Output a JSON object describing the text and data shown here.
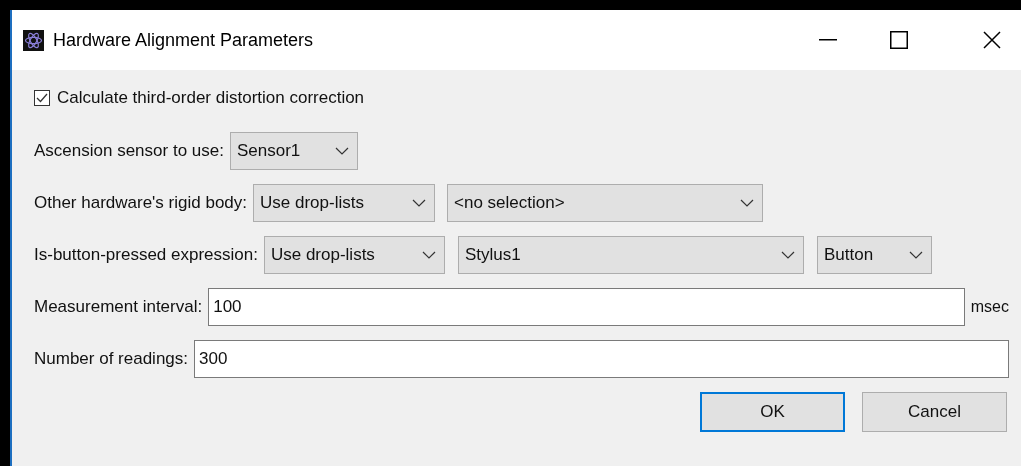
{
  "window": {
    "title": "Hardware Alignment Parameters"
  },
  "checkbox": {
    "label": "Calculate third-order distortion correction",
    "checked": true
  },
  "rows": [
    {
      "kind": "combos",
      "label": "Ascension sensor to use:",
      "combos": [
        {
          "value": "Sensor1"
        }
      ]
    },
    {
      "kind": "combos",
      "label": "Other hardware's rigid body:",
      "combos": [
        {
          "value": "Use drop-lists"
        },
        {
          "value": "<no selection>"
        }
      ]
    },
    {
      "kind": "combos",
      "label": "Is-button-pressed expression:",
      "combos": [
        {
          "value": "Use drop-lists"
        },
        {
          "value": "Stylus1"
        },
        {
          "value": "Button"
        }
      ]
    },
    {
      "kind": "input",
      "label": "Measurement interval:",
      "value": "100",
      "unit": "msec"
    },
    {
      "kind": "input",
      "label": "Number of readings:",
      "value": "300"
    }
  ],
  "buttons": [
    {
      "label": "OK",
      "default": true
    },
    {
      "label": "Cancel",
      "default": false
    }
  ]
}
